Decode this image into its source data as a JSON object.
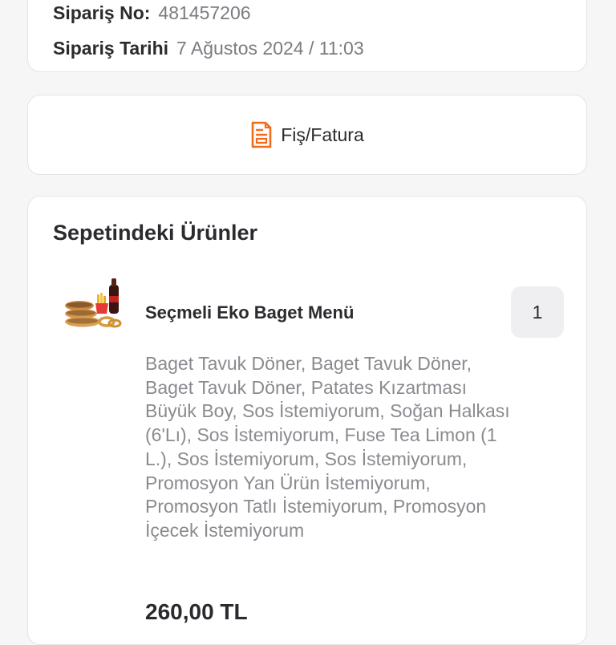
{
  "order": {
    "number_label": "Sipariş No:",
    "number_value": "481457206",
    "date_label": "Sipariş Tarihi",
    "date_value": "7 Ağustos 2024 / 11:03"
  },
  "receipt": {
    "label": "Fiş/Fatura",
    "icon": "receipt-icon",
    "accent_color": "#f26b1d"
  },
  "basket": {
    "title": "Sepetindeki Ürünler",
    "items": [
      {
        "name": "Seçmeli Eko Baget Menü",
        "quantity": "1",
        "description": "Baget Tavuk Döner, Baget Tavuk Döner, Baget Tavuk Döner, Patates Kızartması Büyük Boy, Sos İstemiyorum, Soğan Halkası (6'Lı), Sos İstemiyorum, Fuse Tea Limon (1 L.), Sos İstemiyorum, Sos İstemiyorum, Promosyon Yan Ürün İstemiyorum, Promosyon Tatlı İstemiyorum, Promosyon İçecek İstemiyorum",
        "price": "260,00 TL",
        "image": "menu-photo"
      }
    ]
  }
}
